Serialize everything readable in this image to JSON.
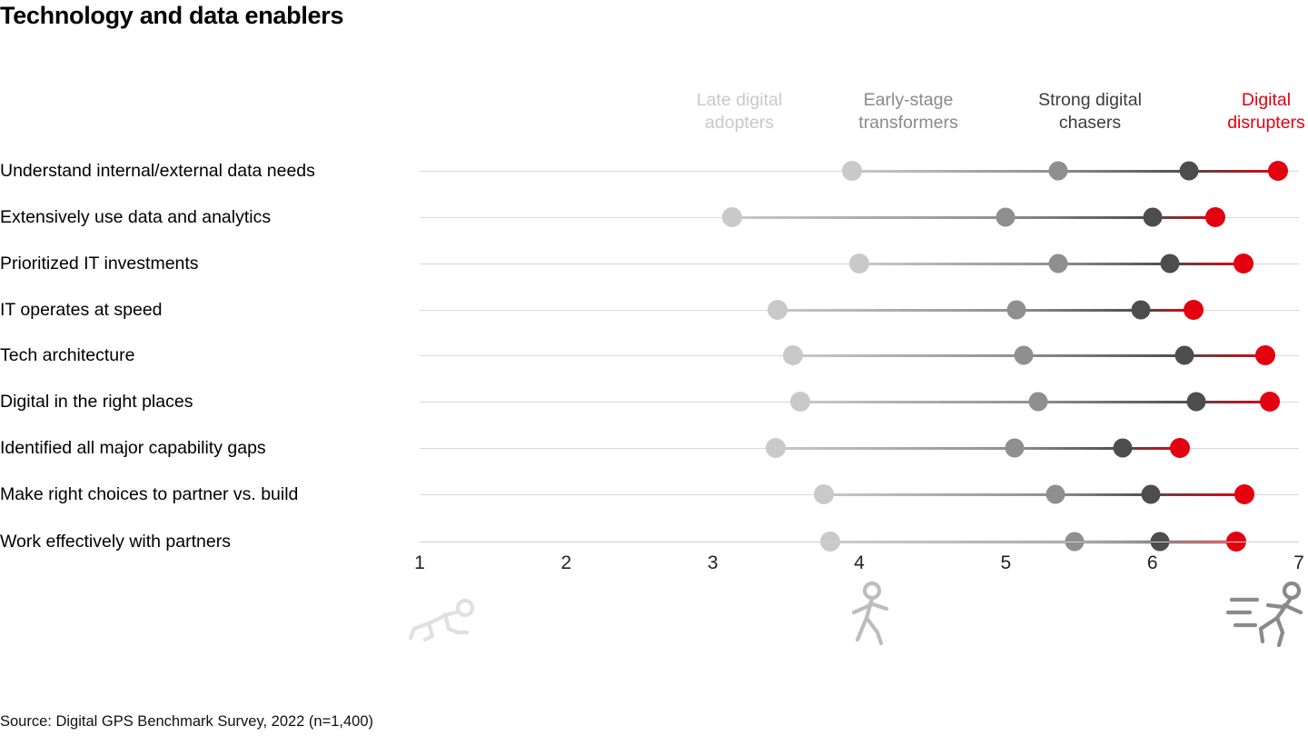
{
  "title": "Technology and data enablers",
  "source": "Source: Digital GPS Benchmark Survey, 2022 (n=1,400)",
  "legend": [
    {
      "line1": "Late digital",
      "line2": "adopters",
      "color": "#c9c9c9"
    },
    {
      "line1": "Early-stage",
      "line2": "transformers",
      "color": "#8f8f8f"
    },
    {
      "line1": "Strong digital",
      "line2": "chasers",
      "color": "#4d4d4d"
    },
    {
      "line1": "Digital",
      "line2": "disrupters",
      "color": "#e3000f"
    }
  ],
  "pictograms": [
    {
      "name": "crawling-figure-icon",
      "at": 4.0,
      "color": "#e0e0e0"
    },
    {
      "name": "walking-figure-icon",
      "at": 4.0,
      "color": "#bdbdbd"
    },
    {
      "name": "running-figure-icon",
      "at": 6.9,
      "color": "#8a8a8a"
    }
  ],
  "chart_data": {
    "type": "scatter",
    "title": "Technology and data enablers",
    "xlabel": "",
    "ylabel": "",
    "xlim": [
      1,
      7
    ],
    "xticks": [
      1,
      2,
      3,
      4,
      5,
      6,
      7
    ],
    "grid": false,
    "legend_position": "top",
    "series": [
      {
        "name": "Late digital adopters",
        "color": "#c9c9c9",
        "values": [
          3.95,
          3.13,
          4.0,
          3.44,
          3.55,
          3.6,
          3.43,
          3.76,
          3.8
        ]
      },
      {
        "name": "Early-stage transformers",
        "color": "#8f8f8f",
        "values": [
          5.36,
          5.0,
          5.36,
          5.07,
          5.12,
          5.22,
          5.06,
          5.34,
          5.47
        ]
      },
      {
        "name": "Strong digital chasers",
        "color": "#4d4d4d",
        "values": [
          6.25,
          6.0,
          6.12,
          5.92,
          6.22,
          6.3,
          5.8,
          5.99,
          6.05
        ]
      },
      {
        "name": "Digital disrupters",
        "color": "#e3000f",
        "values": [
          6.86,
          6.43,
          6.62,
          6.28,
          6.77,
          6.8,
          6.19,
          6.63,
          6.57
        ]
      }
    ],
    "categories": [
      "Understand internal/external data needs",
      "Extensively use data and analytics",
      "Prioritized IT investments",
      "IT operates at speed",
      "Tech architecture",
      "Digital in the right places",
      "Identified all major capability gaps",
      "Make right choices to partner vs. build",
      "Work effectively with partners"
    ]
  }
}
